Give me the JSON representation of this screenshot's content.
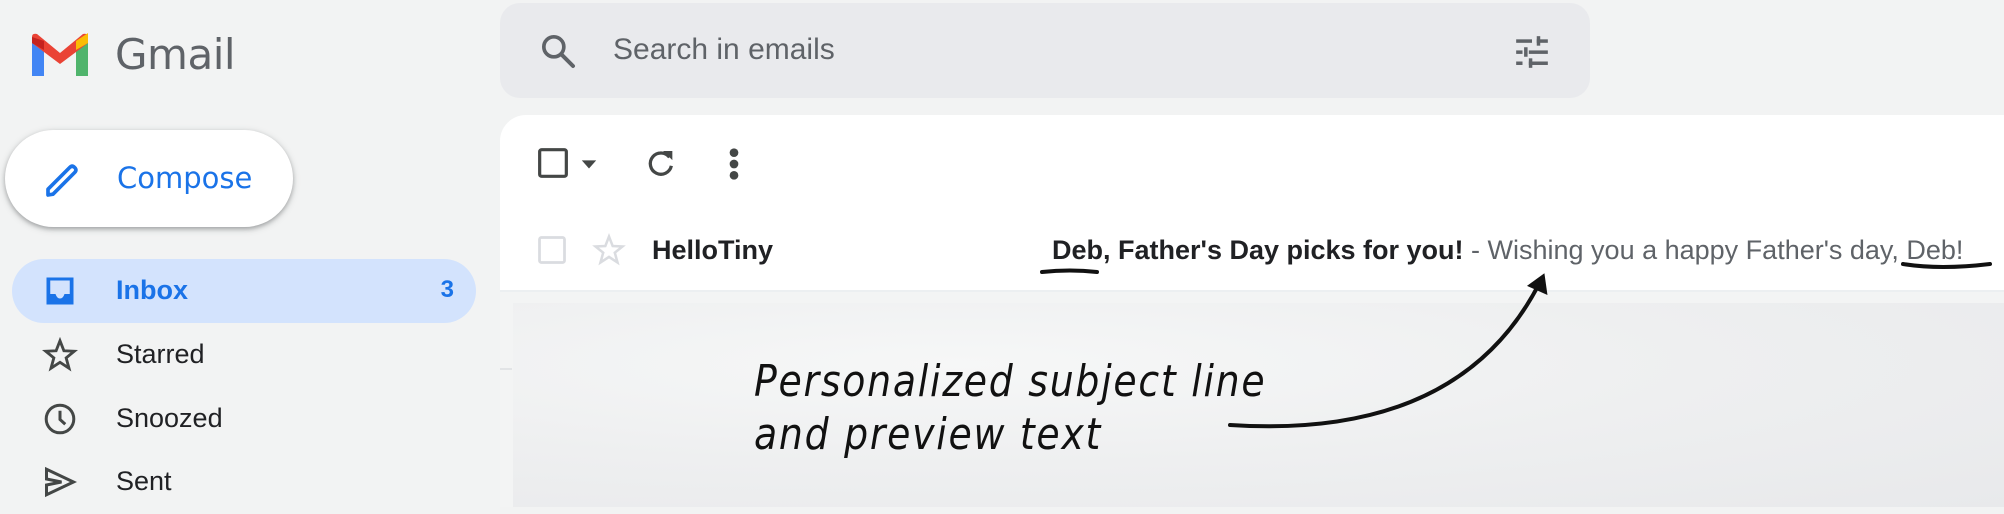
{
  "app": {
    "brand": "Gmail"
  },
  "search": {
    "placeholder": "Search in emails"
  },
  "compose": {
    "label": "Compose"
  },
  "sidebar": {
    "items": [
      {
        "label": "Inbox",
        "count": "3",
        "icon": "inbox-icon",
        "active": true
      },
      {
        "label": "Starred",
        "icon": "star-icon"
      },
      {
        "label": "Snoozed",
        "icon": "clock-icon"
      },
      {
        "label": "Sent",
        "icon": "send-icon"
      }
    ]
  },
  "toolbar": {
    "select_all": "checkbox-icon",
    "select_menu": "caret-down-icon",
    "refresh": "refresh-icon",
    "more": "more-vert-icon"
  },
  "emails": [
    {
      "sender": "HelloTiny",
      "subject": "Deb, Father's Day picks for you!",
      "separator": " - ",
      "snippet": "Wishing you a happy Father's day, Deb!",
      "starred": false,
      "unread": true
    }
  ],
  "annotation": {
    "line1": "Personalized subject line",
    "line2": "and preview text"
  },
  "colors": {
    "accent": "#1a73e8",
    "active_nav_bg": "#d3e3fd",
    "search_bg": "#e9eaed",
    "page_bg": "#f2f3f3"
  }
}
